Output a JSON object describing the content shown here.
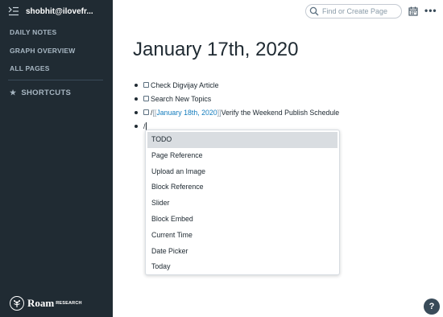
{
  "sidebar": {
    "user": "shobhit@ilovefr...",
    "nav": [
      "DAILY NOTES",
      "GRAPH OVERVIEW",
      "ALL PAGES"
    ],
    "shortcuts_label": "SHORTCUTS",
    "logo": {
      "word": "Roam",
      "sub": "RESEARCH"
    }
  },
  "topbar": {
    "search_placeholder": "Find or Create Page"
  },
  "page": {
    "title": "January 17th, 2020",
    "blocks": [
      {
        "text": "Check Digvijay Article"
      },
      {
        "text": "Search New Topics"
      },
      {
        "prefix": "/",
        "open": "[[",
        "link": "January 18th, 2020",
        "close": "]]",
        "suffix": "Verify the Weekend Publish Schedule"
      },
      {
        "input": "/"
      }
    ]
  },
  "autocomplete": {
    "items": [
      "TODO",
      "Page Reference",
      "Upload an Image",
      "Block Reference",
      "Slider",
      "Block Embed",
      "Current Time",
      "Date Picker",
      "Today"
    ],
    "active_index": 0
  },
  "help": {
    "label": "?"
  },
  "icons": {
    "collapse": "collapse-sidebar-icon",
    "shortcuts": "star-icon",
    "search": "search-icon",
    "calendar": "calendar-icon",
    "more": "more-icon",
    "help": "help-icon"
  },
  "colors": {
    "sidebar_bg": "#202b33",
    "link": "#137cbd",
    "active_item_bg": "#d9dde1"
  }
}
